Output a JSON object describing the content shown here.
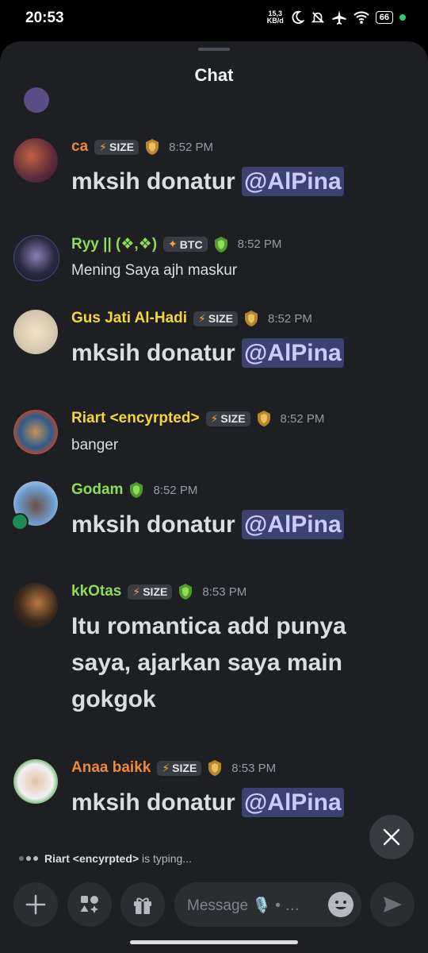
{
  "status": {
    "time": "20:53",
    "net_value": "15,3",
    "net_unit": "KB/d",
    "battery": "66"
  },
  "header": {
    "title": "Chat"
  },
  "messages": [
    {
      "user": "ca",
      "user_color": "#f0883a",
      "tag": "SIZE",
      "time": "8:52 PM",
      "text": "mksih donatur",
      "mention": "@AlPina",
      "big": true
    },
    {
      "user": "Ryy || (❖,❖)",
      "user_color": "#8fdc56",
      "tag": "BTC",
      "time": "8:52 PM",
      "text": "Mening Saya ajh maskur",
      "big": false
    },
    {
      "user": "Gus Jati Al-Hadi",
      "user_color": "#f5d53c",
      "tag": "SIZE",
      "time": "8:52 PM",
      "text": "mksih donatur",
      "mention": "@AlPina",
      "big": true
    },
    {
      "user": "Riart <encyrpted>",
      "user_color": "#f5d53c",
      "tag": "SIZE",
      "time": "8:52 PM",
      "text": "banger",
      "big": false
    },
    {
      "user": "Godam",
      "user_color": "#8fdc56",
      "time": "8:52 PM",
      "text": "mksih donatur",
      "mention": "@AlPina",
      "big": true
    },
    {
      "user": "kkOtas",
      "user_color": "#8fdc56",
      "tag": "SIZE",
      "time": "8:53 PM",
      "text_lines": [
        "Itu romantica add punya",
        "saya, ajarkan saya main",
        "gokgok"
      ],
      "big": true
    },
    {
      "user": "Anaa baikk",
      "user_color": "#f0883a",
      "tag": "SIZE",
      "time": "8:53 PM",
      "text": "mksih donatur",
      "mention": "@AlPina",
      "big": true
    }
  ],
  "typing": {
    "name": "Riart <encyrpted>",
    "suffix": " is typing..."
  },
  "composer": {
    "placeholder": "Message 🎙️ • …"
  },
  "colors": {
    "background": "#1e1f22",
    "mention_bg": "#3c4270",
    "tag_bg": "#3a3c43"
  }
}
